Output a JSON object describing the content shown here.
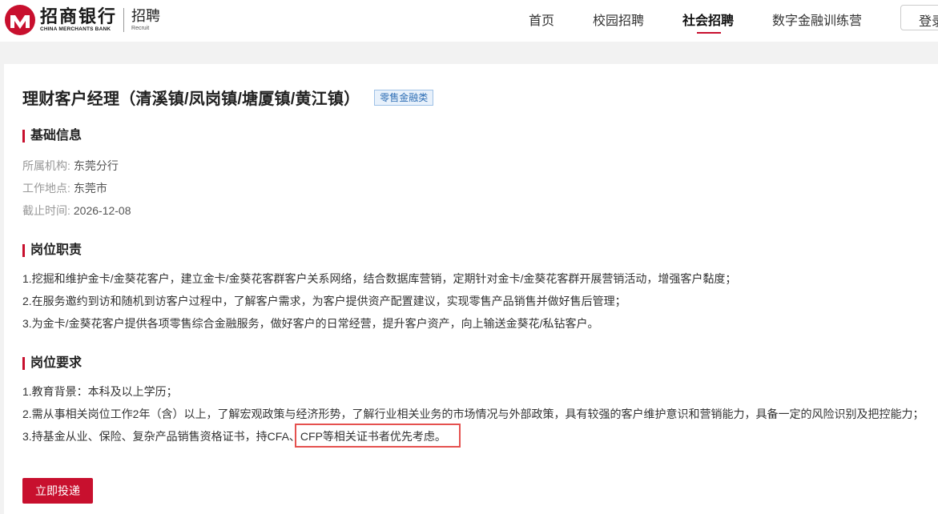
{
  "header": {
    "logo": {
      "cn": "招商银行",
      "en": "CHINA MERCHANTS BANK",
      "sub_cn": "招聘",
      "sub_en": "Recruit"
    },
    "nav": [
      {
        "label": "首页",
        "active": false
      },
      {
        "label": "校园招聘",
        "active": false
      },
      {
        "label": "社会招聘",
        "active": true
      },
      {
        "label": "数字金融训练营",
        "active": false
      }
    ],
    "login_label": "登录"
  },
  "job": {
    "title": "理财客户经理（清溪镇/凤岗镇/塘厦镇/黄江镇）",
    "category": "零售金融类"
  },
  "basic_info": {
    "heading": "基础信息",
    "rows": [
      {
        "label": "所属机构:",
        "value": "东莞分行"
      },
      {
        "label": "工作地点:",
        "value": "东莞市"
      },
      {
        "label": "截止时间:",
        "value": "2026-12-08"
      }
    ]
  },
  "duties": {
    "heading": "岗位职责",
    "items": [
      "1.挖掘和维护金卡/金葵花客户，建立金卡/金葵花客群客户关系网络，结合数据库营销，定期针对金卡/金葵花客群开展营销活动，增强客户黏度；",
      "2.在服务邀约到访和随机到访客户过程中，了解客户需求，为客户提供资产配置建议，实现零售产品销售并做好售后管理；",
      "3.为金卡/金葵花客户提供各项零售综合金融服务，做好客户的日常经营，提升客户资产，向上输送金葵花/私钻客户。"
    ]
  },
  "requirements": {
    "heading": "岗位要求",
    "items": [
      "1.教育背景：本科及以上学历；",
      "2.需从事相关岗位工作2年（含）以上，了解宏观政策与经济形势，了解行业相关业务的市场情况与外部政策，具有较强的客户维护意识和营销能力，具备一定的风险识别及把控能力；",
      "3.持基金从业、保险、复杂产品销售资格证书，持CFA、CFP等相关证书者优先考虑。"
    ]
  },
  "apply_label": "立即投递",
  "colors": {
    "brand_red": "#c8102e",
    "highlight_box": "#e5514f",
    "badge_blue": "#2f6fb5"
  }
}
